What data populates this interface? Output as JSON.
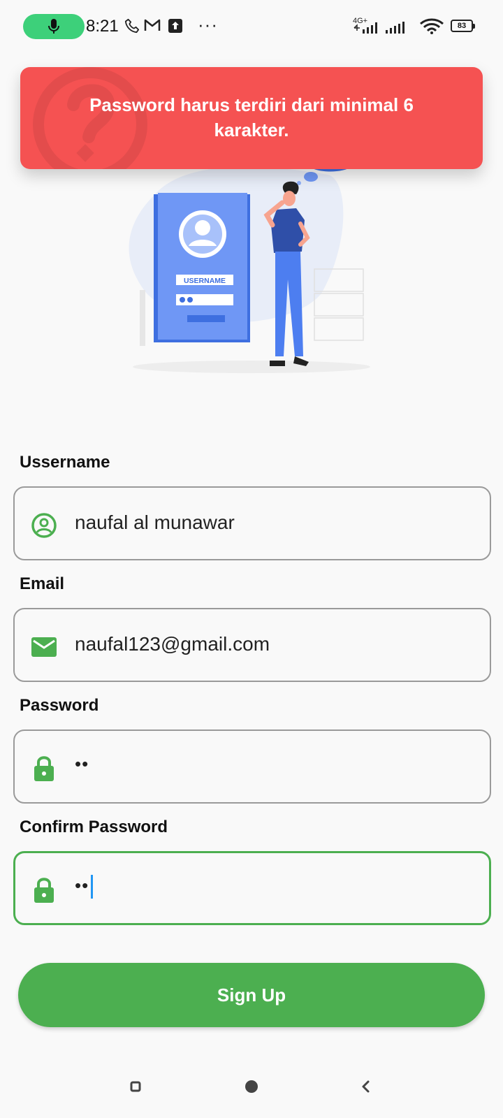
{
  "status_bar": {
    "time": "8:21",
    "network": "4G+",
    "battery": "83",
    "more": "···"
  },
  "toast": {
    "message": "Password harus terdiri dari minimal 6 karakter."
  },
  "illustration": {
    "card_label": "USERNAME"
  },
  "form": {
    "username": {
      "label": "Ussername",
      "value": "naufal al munawar",
      "icon": "account-circle-icon"
    },
    "email": {
      "label": "Email",
      "value": "naufal123@gmail.com",
      "icon": "mail-icon"
    },
    "password": {
      "label": "Password",
      "value": "••",
      "icon": "lock-icon"
    },
    "confirm_password": {
      "label": "Confirm Password",
      "value": "••",
      "icon": "lock-icon"
    },
    "submit_label": "Sign Up"
  },
  "colors": {
    "accent": "#4caf50",
    "toast": "#f55252",
    "illustration_blue": "#4d7ef0"
  }
}
